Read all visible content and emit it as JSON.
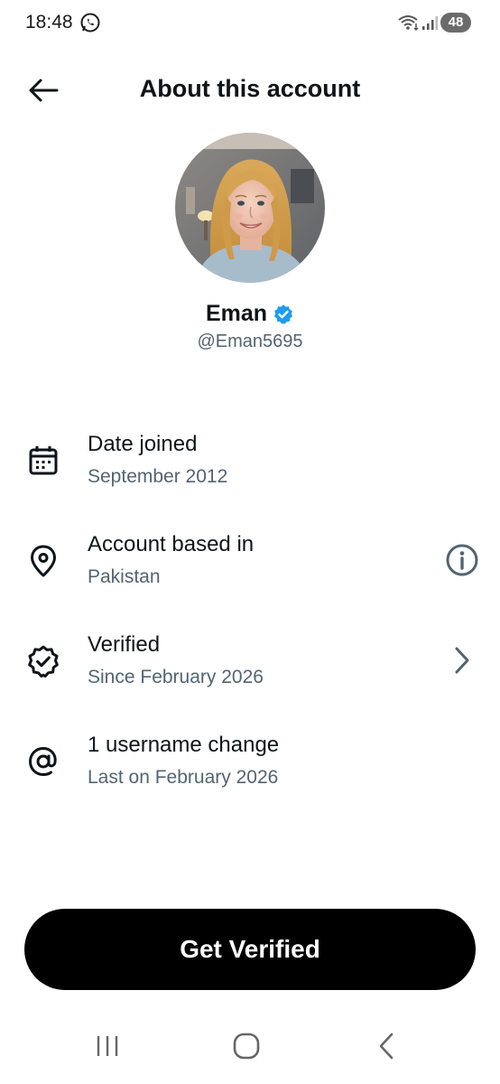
{
  "status_bar": {
    "time": "18:48",
    "battery": "48",
    "icons": [
      "whatsapp-icon",
      "wifi-icon",
      "signal-icon"
    ]
  },
  "header": {
    "title": "About this account",
    "back_icon": "arrow-left-icon"
  },
  "profile": {
    "display_name": "Eman",
    "handle": "@Eman5695",
    "verified": true,
    "badge_color": "#1d9bf0"
  },
  "info_items": [
    {
      "icon": "calendar-icon",
      "title": "Date joined",
      "subtitle": "September 2012"
    },
    {
      "icon": "location-pin-icon",
      "title": "Account based in",
      "subtitle": "Pakistan",
      "trailing": "info-icon"
    },
    {
      "icon": "verified-seal-icon",
      "title": "Verified",
      "subtitle": "Since February 2026",
      "trailing": "chevron-right-icon"
    },
    {
      "icon": "at-sign-icon",
      "title": "1 username change",
      "subtitle": "Last on February 2026"
    }
  ],
  "cta": {
    "label": "Get Verified"
  },
  "colors": {
    "primary_text": "#0f1419",
    "secondary_text": "#536471",
    "button_bg": "#000000",
    "button_text": "#ffffff"
  },
  "nav": {
    "buttons": [
      "recent-apps-icon",
      "home-icon",
      "back-nav-icon"
    ]
  }
}
